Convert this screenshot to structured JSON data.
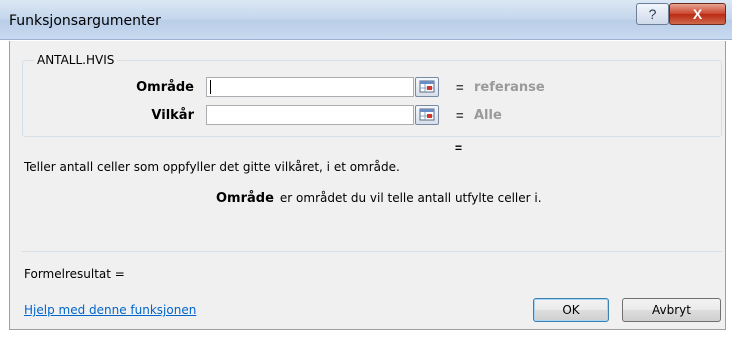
{
  "window": {
    "title": "Funksjonsargumenter",
    "help_symbol": "?",
    "close_symbol": "X"
  },
  "function": {
    "name": "ANTALL.HVIS",
    "arguments": [
      {
        "label": "Område",
        "value": "",
        "result": "referanse"
      },
      {
        "label": "Vilkår",
        "value": "",
        "result": "Alle"
      }
    ],
    "equals": "=",
    "result_equals": "=",
    "description": "Teller antall celler som oppfyller det gitte vilkåret, i et område.",
    "argument_help": {
      "name": "Område",
      "text": "er området du vil telle antall utfylte celler i."
    }
  },
  "footer": {
    "formula_result": "Formelresultat =",
    "help_link": "Hjelp med denne funksjonen",
    "ok_label": "OK",
    "cancel_label": "Avbryt"
  },
  "colors": {
    "title_bar": "#c4d6ec",
    "close_button": "#c9452c",
    "link": "#0066cc",
    "placeholder_value": "#9a9a9a"
  }
}
